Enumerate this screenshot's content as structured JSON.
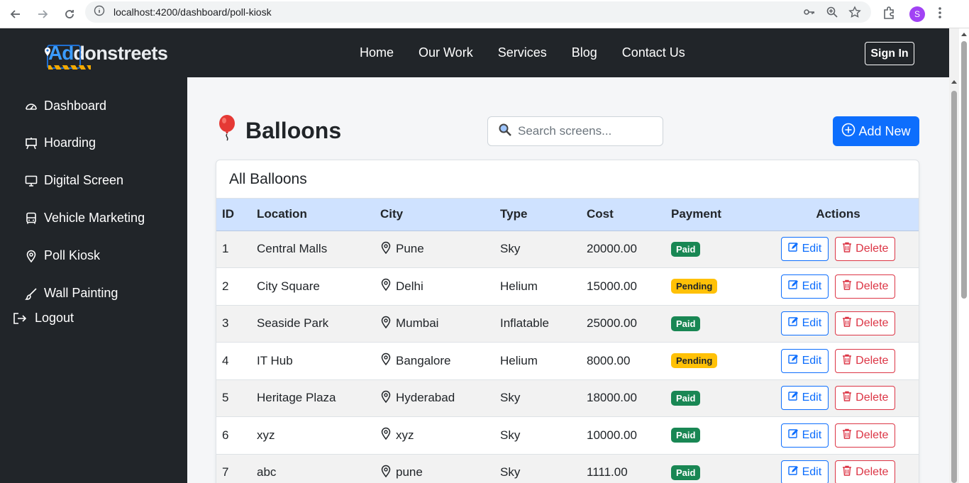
{
  "browser": {
    "url": "localhost:4200/dashboard/poll-kiosk",
    "profile_initial": "S"
  },
  "navbar": {
    "logo_ad": "Ad",
    "logo_rest": "donstreets",
    "links": [
      "Home",
      "Our Work",
      "Services",
      "Blog",
      "Contact Us"
    ],
    "signin_label": "Sign In"
  },
  "sidebar": {
    "items": [
      {
        "label": "Dashboard",
        "icon": "speedometer-icon"
      },
      {
        "label": "Hoarding",
        "icon": "easel-icon"
      },
      {
        "label": "Digital Screen",
        "icon": "monitor-icon"
      },
      {
        "label": "Vehicle Marketing",
        "icon": "bus-icon"
      },
      {
        "label": "Poll Kiosk",
        "icon": "location-pin-icon"
      },
      {
        "label": "Wall Painting",
        "icon": "brush-icon"
      }
    ],
    "logout_label": "Logout"
  },
  "main": {
    "title": "Balloons",
    "search_placeholder": "Search screens...",
    "add_label": "Add New",
    "card_title": "All Balloons",
    "columns": [
      "ID",
      "Location",
      "City",
      "Type",
      "Cost",
      "Payment",
      "Actions"
    ],
    "edit_label": "Edit",
    "delete_label": "Delete",
    "rows": [
      {
        "id": "1",
        "location": "Central Malls",
        "city": "Pune",
        "type": "Sky",
        "cost": "20000.00",
        "payment": "Paid"
      },
      {
        "id": "2",
        "location": "City Square",
        "city": "Delhi",
        "type": "Helium",
        "cost": "15000.00",
        "payment": "Pending"
      },
      {
        "id": "3",
        "location": "Seaside Park",
        "city": "Mumbai",
        "type": "Inflatable",
        "cost": "25000.00",
        "payment": "Paid"
      },
      {
        "id": "4",
        "location": "IT Hub",
        "city": "Bangalore",
        "type": "Helium",
        "cost": "8000.00",
        "payment": "Pending"
      },
      {
        "id": "5",
        "location": "Heritage Plaza",
        "city": "Hyderabad",
        "type": "Sky",
        "cost": "18000.00",
        "payment": "Paid"
      },
      {
        "id": "6",
        "location": "xyz",
        "city": "xyz",
        "type": "Sky",
        "cost": "10000.00",
        "payment": "Paid"
      },
      {
        "id": "7",
        "location": "abc",
        "city": "pune",
        "type": "Sky",
        "cost": "1111.00",
        "payment": "Paid"
      }
    ]
  },
  "colors": {
    "primary": "#0d6efd",
    "danger": "#dc3545",
    "success": "#198754",
    "warning": "#ffc107",
    "dark": "#212529",
    "table_header": "#cfe2ff"
  }
}
